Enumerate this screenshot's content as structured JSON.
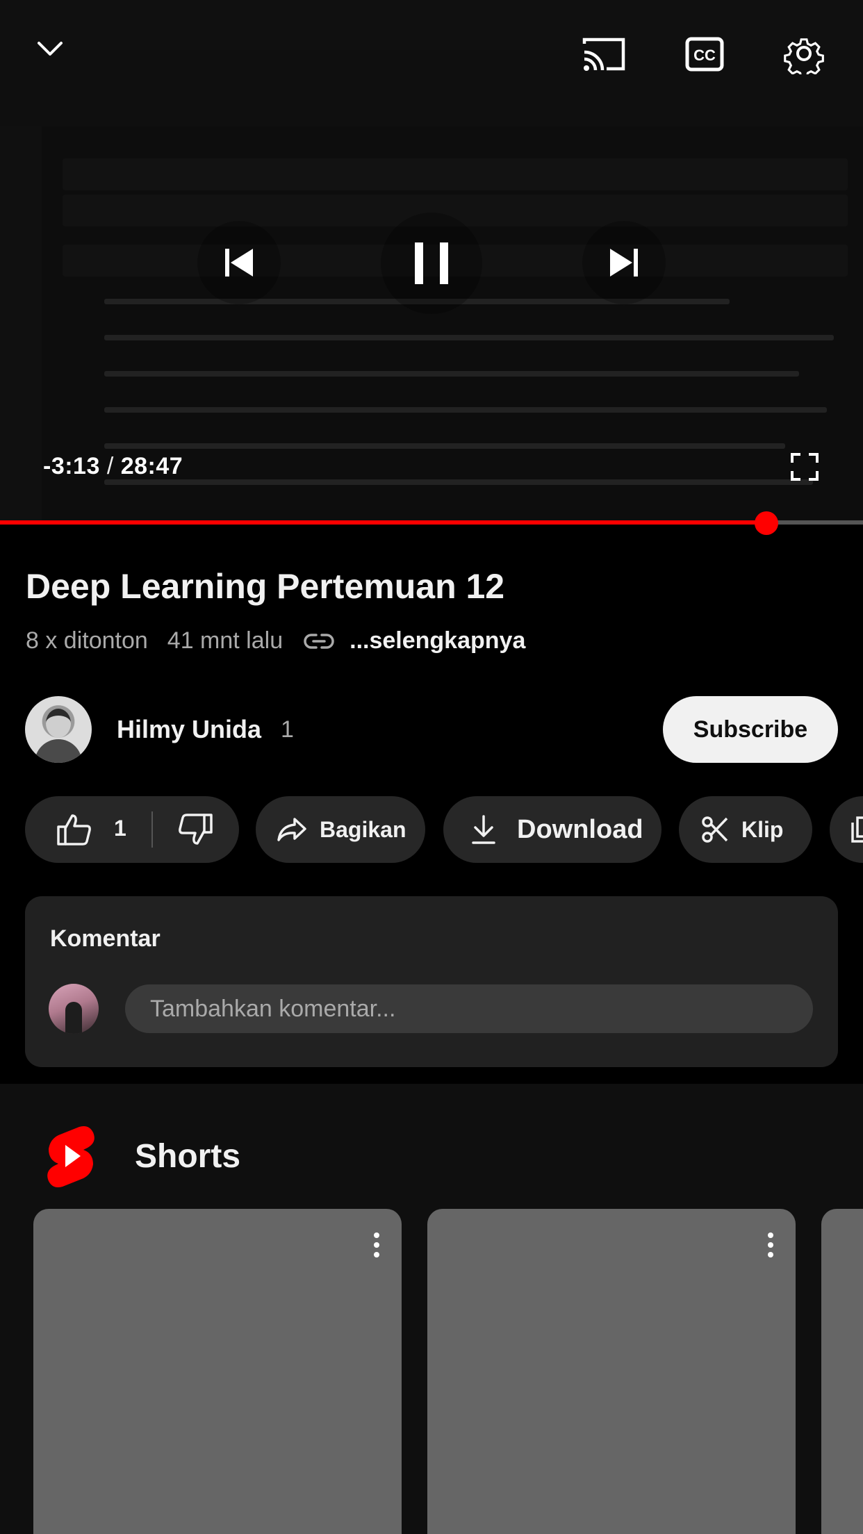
{
  "player": {
    "time_remaining": "-3:13",
    "time_separator": "/",
    "duration": "28:47",
    "progress": 0.888,
    "accent_color": "#ff0000"
  },
  "icons": {
    "collapse": "chevron-down-icon",
    "cast": "cast-icon",
    "captions": "captions-icon",
    "settings": "gear-icon",
    "previous": "skip-previous-icon",
    "pause": "pause-icon",
    "next": "skip-next-icon",
    "fullscreen": "fullscreen-icon",
    "like": "thumbs-up-icon",
    "dislike": "thumbs-down-icon",
    "share": "share-icon",
    "download": "download-icon",
    "clip": "scissors-icon",
    "save": "save-to-playlist-icon",
    "link": "link-icon",
    "shorts": "shorts-logo-icon",
    "more": "more-vert-icon"
  },
  "video": {
    "title": "Deep Learning Pertemuan 12",
    "views": "8 x ditonton",
    "age": "41 mnt lalu",
    "more_label": "...selengkapnya"
  },
  "channel": {
    "name": "Hilmy Unida",
    "subscribers": "1",
    "subscribe_label": "Subscribe"
  },
  "actions": {
    "like_count": "1",
    "share_label": "Bagikan",
    "download_label": "Download",
    "clip_label": "Klip"
  },
  "comments": {
    "title": "Komentar",
    "input_placeholder": "Tambahkan komentar..."
  },
  "shorts": {
    "title": "Shorts",
    "logo_color": "#ff0000"
  }
}
